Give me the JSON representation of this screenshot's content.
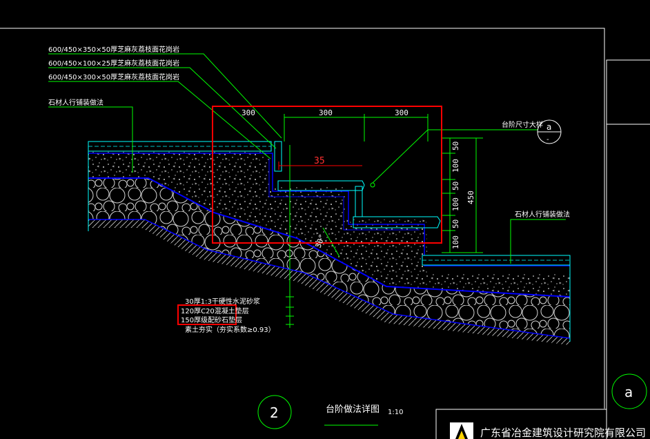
{
  "notes_top": [
    "600/450×350×50厚芝麻灰荔枝面花岗岩",
    "600/450×100×25厚芝麻灰荔枝面花岗岩",
    "600/450×300×50厚芝麻灰荔枝面花岗岩"
  ],
  "left_label": "石材人行铺装做法",
  "right_label": "石材人行铺装做法",
  "dims_top": [
    "300",
    "300",
    "300"
  ],
  "dim_red": "35",
  "dims_right": [
    "50",
    "100",
    "50",
    "100",
    "50",
    "100"
  ],
  "dim_total": "450",
  "step_detail_label": "台阶尺寸大样",
  "callout_top": "a",
  "callout_top_sub": "-",
  "callout_sheet": "a",
  "angle_label": "30°",
  "layers": [
    "30厚1:3干硬性水泥砂浆",
    "120厚C20混凝土垫层",
    "150厚级配砂石垫层",
    "素土夯实（夯实系数≥0.93）"
  ],
  "detail_number": "2",
  "detail_title": "台阶做法详图",
  "detail_scale": "1:10",
  "company": "广东省冶金建筑设计研究院有限公司",
  "colors": {
    "background": "#000000",
    "leader": "#00ff00",
    "layer_line": "#0000ff",
    "highlight": "#ff0000",
    "dim_line": "#00ff00",
    "cyan": "#00ffff"
  }
}
